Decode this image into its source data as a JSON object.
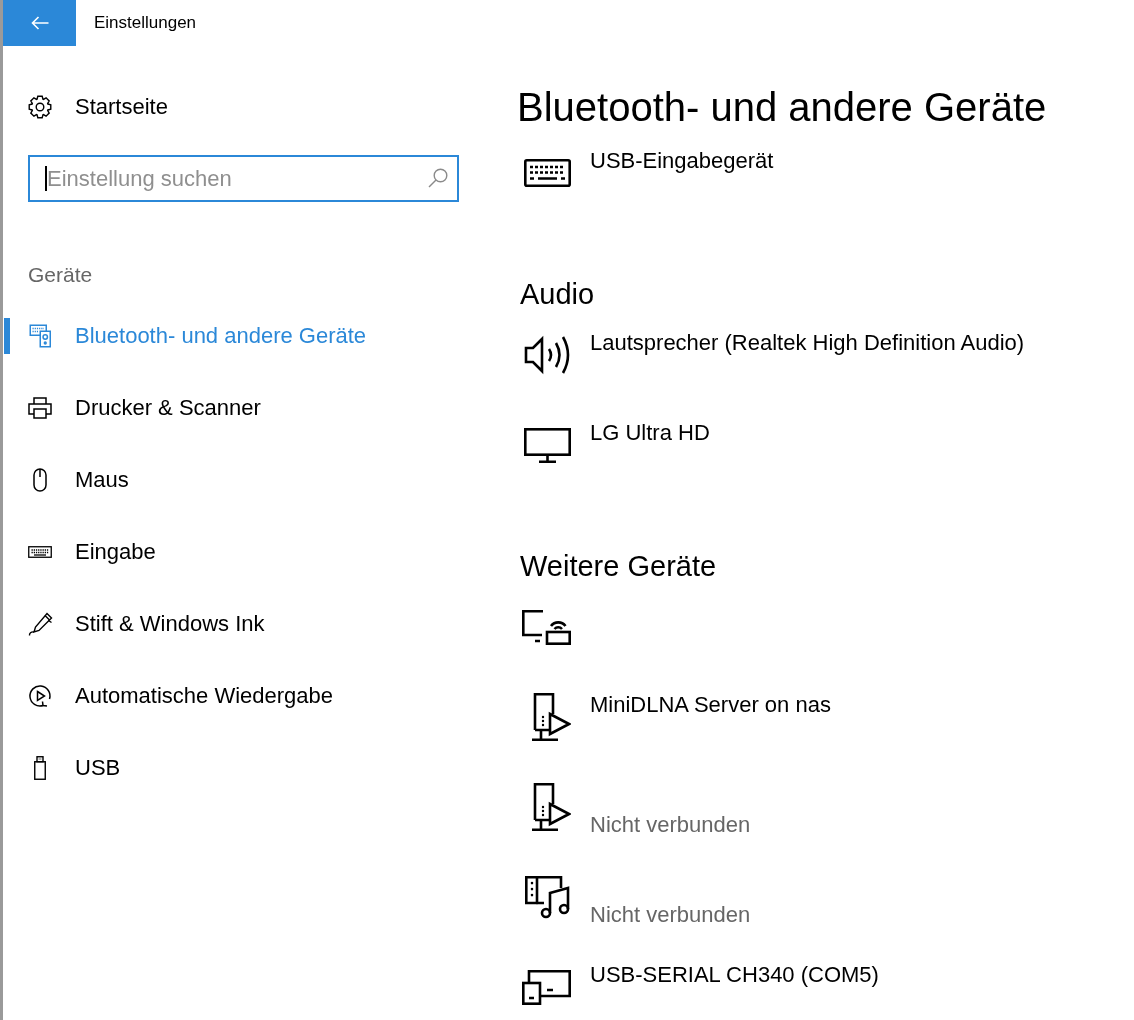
{
  "window": {
    "title": "Einstellungen"
  },
  "sidebar": {
    "home": {
      "label": "Startseite"
    },
    "search": {
      "placeholder": "Einstellung suchen",
      "focused": true
    },
    "group": "Geräte",
    "items": [
      {
        "label": "Bluetooth- und andere Geräte",
        "kind": "devices",
        "selected": true
      },
      {
        "label": "Drucker & Scanner",
        "kind": "printer",
        "selected": false
      },
      {
        "label": "Maus",
        "kind": "mouse",
        "selected": false
      },
      {
        "label": "Eingabe",
        "kind": "typing",
        "selected": false
      },
      {
        "label": "Stift & Windows Ink",
        "kind": "pen",
        "selected": false
      },
      {
        "label": "Automatische Wiedergabe",
        "kind": "autoplay",
        "selected": false
      },
      {
        "label": "USB",
        "kind": "usb",
        "selected": false
      }
    ]
  },
  "page": {
    "title": "Bluetooth- und andere Geräte",
    "sections": [
      {
        "devices": [
          {
            "kind": "keyboard",
            "name": "USB-Eingabegerät"
          }
        ]
      },
      {
        "heading": "Audio",
        "devices": [
          {
            "kind": "speaker",
            "name": "Lautsprecher (Realtek High Definition Audio)"
          },
          {
            "kind": "monitor",
            "name": "LG Ultra HD"
          }
        ]
      },
      {
        "heading": "Weitere Geräte",
        "devices": [
          {
            "kind": "cast"
          },
          {
            "kind": "media-server",
            "name": "MiniDLNA Server on nas"
          },
          {
            "kind": "media-server",
            "status": "Nicht verbunden"
          },
          {
            "kind": "media",
            "status": "Nicht verbunden"
          },
          {
            "kind": "serial",
            "name": "USB-SERIAL CH340 (COM5)"
          }
        ]
      }
    ]
  }
}
